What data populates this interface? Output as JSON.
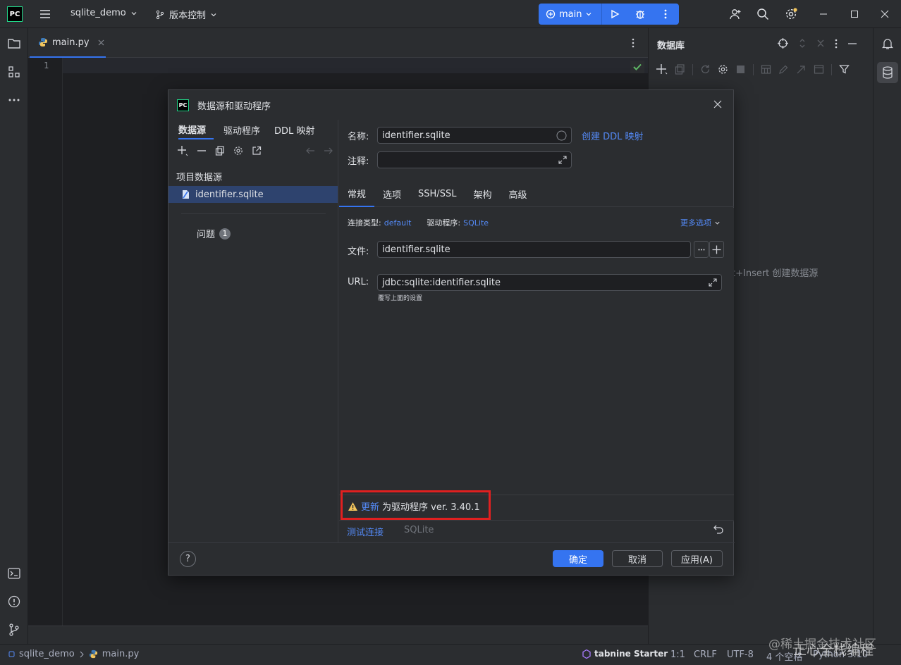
{
  "titlebar": {
    "logo": "PC",
    "project": "sqlite_demo",
    "vcs": "版本控制",
    "run_config": "main"
  },
  "editor": {
    "tab_label": "main.py",
    "line_number": "1"
  },
  "db_panel": {
    "title": "数据库",
    "hint": "t+Insert 创建数据源"
  },
  "dialog": {
    "title": "数据源和驱动程序",
    "left_tabs": [
      "数据源",
      "驱动程序",
      "DDL 映射"
    ],
    "section_label": "项目数据源",
    "selected_source": "identifier.sqlite",
    "problems_label": "问题",
    "problems_count": "1",
    "name_label": "名称:",
    "name_value": "identifier.sqlite",
    "create_ddl_link": "创建 DDL 映射",
    "comment_label": "注释:",
    "comment_value": "",
    "tabs": [
      "常规",
      "选项",
      "SSH/SSL",
      "架构",
      "高级"
    ],
    "conn_type_label": "连接类型:",
    "conn_type_value": "default",
    "driver_label": "驱动程序:",
    "driver_value": "SQLite",
    "more_options": "更多选项",
    "file_label": "文件:",
    "file_value": "identifier.sqlite",
    "url_label": "URL:",
    "url_value": "jdbc:sqlite:identifier.sqlite",
    "url_hint": "覆写上面的设置",
    "update_link": "更新",
    "update_text": "为驱动程序 ver. 3.40.1",
    "test_link": "测试连接",
    "test_driver": "SQLite",
    "help": "?",
    "ok": "确定",
    "cancel": "取消",
    "apply": "应用(A)"
  },
  "statusbar": {
    "project": "sqlite_demo",
    "file": "main.py",
    "tabnine": "tabnine Starter",
    "position": "1:1",
    "line_sep": "CRLF",
    "encoding": "UTF-8",
    "indent": "4 个空格",
    "interpreter": "Python 3.10",
    "watermark": "@稀土掘金技术社区",
    "watermark2": "正心全栈编程"
  },
  "colors": {
    "accent": "#3574f0",
    "link": "#548af7",
    "warning": "#f2c55c",
    "highlight_box": "#e02020",
    "success": "#5fb865"
  }
}
